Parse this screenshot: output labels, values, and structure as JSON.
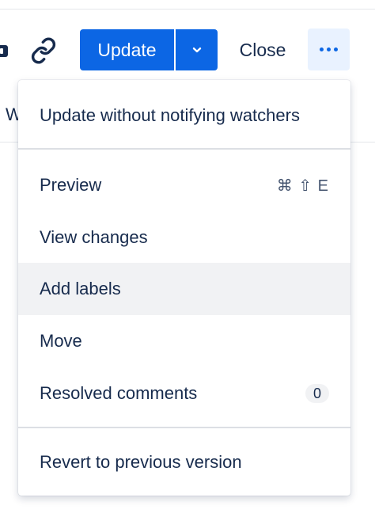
{
  "toolbar": {
    "update_label": "Update",
    "close_label": "Close"
  },
  "background": {
    "partial_tab_letter": "W"
  },
  "menu": {
    "items": [
      {
        "label": "Update without notifying watchers"
      },
      {
        "label": "Preview",
        "shortcut": "⌘ ⇧ E"
      },
      {
        "label": "View changes"
      },
      {
        "label": "Add labels",
        "state": "hovered"
      },
      {
        "label": "Move"
      },
      {
        "label": "Resolved comments",
        "badge": "0"
      },
      {
        "label": "Revert to previous version"
      }
    ]
  },
  "icons": [
    "link-icon",
    "chevron-down-icon",
    "more-horizontal-icon"
  ],
  "colors": {
    "primary": "#0c66e4",
    "text": "#172b4d",
    "subtle_bg": "#e9f2ff",
    "hover_bg": "#f1f2f4"
  }
}
